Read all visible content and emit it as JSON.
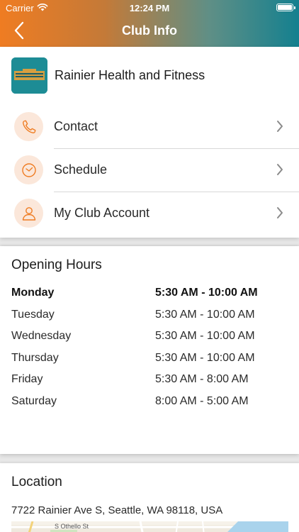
{
  "status_bar": {
    "carrier": "Carrier",
    "time": "12:24 PM"
  },
  "nav": {
    "title": "Club Info",
    "back_icon": "chevron-left-icon"
  },
  "club": {
    "name": "Rainier Health and Fitness",
    "logo_text": "RAINIER HEALTH & FITNESS"
  },
  "menu": [
    {
      "label": "Contact",
      "icon": "phone-icon"
    },
    {
      "label": "Schedule",
      "icon": "clock-icon"
    },
    {
      "label": "My Club Account",
      "icon": "user-icon"
    }
  ],
  "hours": {
    "title": "Opening Hours",
    "rows": [
      {
        "day": "Monday",
        "time": "5:30 AM - 10:00 AM"
      },
      {
        "day": "Tuesday",
        "time": "5:30 AM - 10:00 AM"
      },
      {
        "day": "Wednesday",
        "time": "5:30 AM - 10:00 AM"
      },
      {
        "day": "Thursday",
        "time": "5:30 AM - 10:00 AM"
      },
      {
        "day": "Friday",
        "time": "5:30 AM - 8:00 AM"
      },
      {
        "day": "Saturday",
        "time": "8:00 AM - 5:00 AM"
      }
    ]
  },
  "location": {
    "title": "Location",
    "address": "7722 Rainier Ave S, Seattle, WA 98118, USA",
    "map_street": "S Othello St"
  },
  "colors": {
    "header_start": "#ef7c22",
    "header_end": "#14808f",
    "icon_accent": "#ef7c22",
    "icon_bg": "#fbe7da"
  }
}
